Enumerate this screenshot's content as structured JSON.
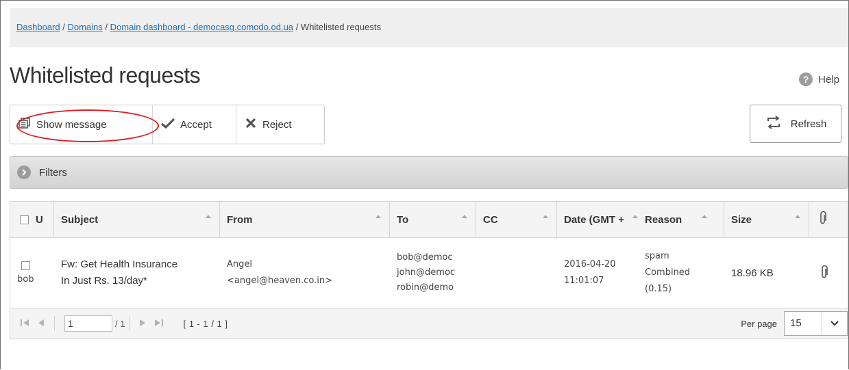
{
  "breadcrumb": {
    "items": [
      "Dashboard",
      "Domains",
      "Domain dashboard - democasg.comodo.od.ua"
    ],
    "separator": "/",
    "current": "Whitelisted requests"
  },
  "page": {
    "title": "Whitelisted requests",
    "help_label": "Help",
    "help_icon": "question-circle-icon"
  },
  "toolbar": {
    "show_message": "Show message",
    "accept": "Accept",
    "reject": "Reject",
    "refresh": "Refresh"
  },
  "filters": {
    "label": "Filters"
  },
  "table": {
    "columns": [
      "U",
      "Subject",
      "From",
      "To",
      "CC",
      "Date (GMT +",
      "Reason",
      "Size"
    ],
    "rows": [
      {
        "user": "bob",
        "subject": [
          "Fw: Get Health Insurance",
          "In Just Rs. 13/day*"
        ],
        "from": [
          "Angel",
          "<angel@heaven.co.in>"
        ],
        "to": [
          "bob@democ",
          "john@democ",
          "robin@demo"
        ],
        "cc": "",
        "date": [
          "2016-04-20",
          "11:01:07"
        ],
        "reason": [
          "spam",
          "Combined",
          "(0.15)"
        ],
        "size": "18.96 KB",
        "has_attachment": true
      }
    ]
  },
  "pager": {
    "page": "1",
    "total": "/ 1",
    "range": "[ 1 - 1 / 1 ]",
    "per_page_label": "Per page",
    "per_page_value": "15"
  },
  "colors": {
    "link": "#1d6fb5",
    "highlight_ellipse": "#e01e1e"
  }
}
